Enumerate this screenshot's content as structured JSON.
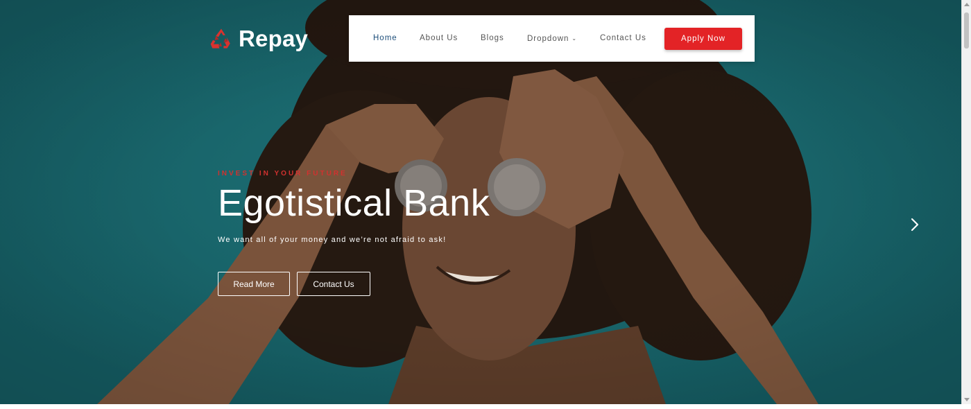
{
  "brand": {
    "name": "Repay",
    "icon": "recycle-icon",
    "color": "#d9322f"
  },
  "nav": {
    "items": [
      {
        "label": "Home",
        "active": true
      },
      {
        "label": "About Us",
        "active": false
      },
      {
        "label": "Blogs",
        "active": false
      },
      {
        "label": "Dropdown",
        "active": false,
        "has_caret": true
      },
      {
        "label": "Contact Us",
        "active": false
      }
    ],
    "apply_label": "Apply Now",
    "accent": "#e32326"
  },
  "hero": {
    "eyebrow": "INVEST IN YOUR FUTURE",
    "title": "Egotistical Bank",
    "subtitle": "We want all of your money and we’re not afraid to ask!",
    "buttons": {
      "read_more": "Read More",
      "contact": "Contact Us"
    },
    "next_icon": "chevron-right-icon",
    "background_color": "#17666c"
  }
}
